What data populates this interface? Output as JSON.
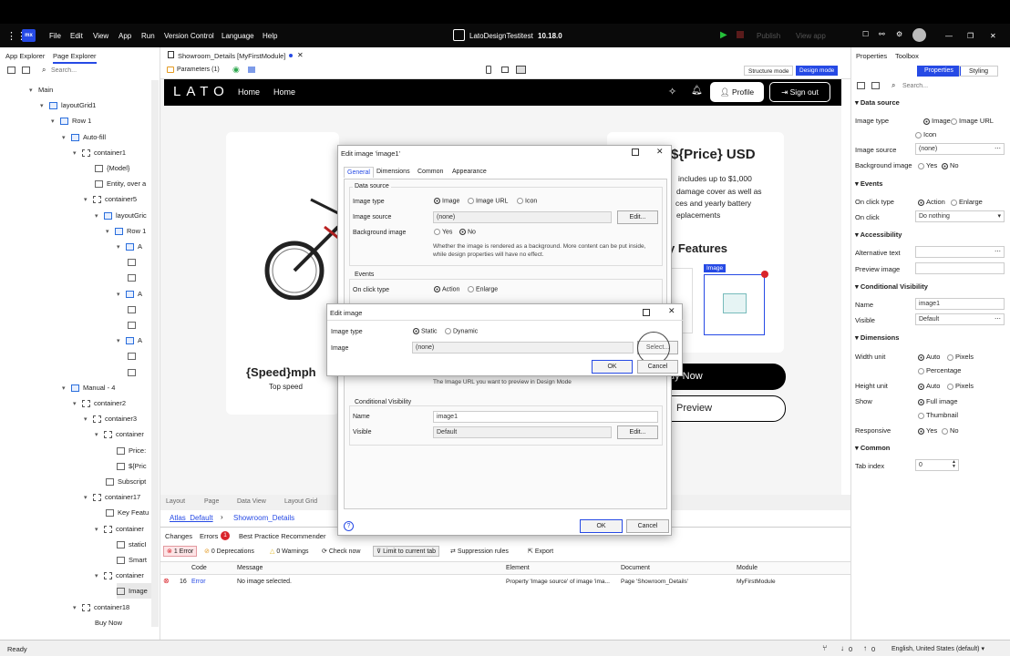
{
  "menubar": {
    "items": [
      "File",
      "Edit",
      "View",
      "App",
      "Run",
      "Version Control",
      "Language",
      "Help"
    ],
    "project_title": "LatoDesignTestitest",
    "version": "10.18.0",
    "publish_label": "Publish",
    "view_app_label": "View app"
  },
  "left_panel": {
    "tabs": [
      "App Explorer",
      "Page Explorer"
    ],
    "search_placeholder": "Search...",
    "tree": [
      {
        "label": "Main",
        "indent": 32,
        "chev": "▾",
        "icon": "none"
      },
      {
        "label": "layoutGrid1",
        "indent": 44,
        "chev": "▾",
        "icon": "grid"
      },
      {
        "label": "Row 1",
        "indent": 56,
        "chev": "▾",
        "icon": "row"
      },
      {
        "label": "Auto-fill",
        "indent": 68,
        "chev": "▾",
        "icon": "col"
      },
      {
        "label": "container1",
        "indent": 80,
        "chev": "▾",
        "icon": "dash"
      },
      {
        "label": "{Model}",
        "indent": 104,
        "chev": "",
        "icon": "text"
      },
      {
        "label": "Entity, over a",
        "indent": 104,
        "chev": "",
        "icon": "text"
      },
      {
        "label": "container5",
        "indent": 92,
        "chev": "▾",
        "icon": "dash"
      },
      {
        "label": "layoutGric",
        "indent": 104,
        "chev": "▾",
        "icon": "grid"
      },
      {
        "label": "Row 1",
        "indent": 116,
        "chev": "▾",
        "icon": "row"
      },
      {
        "label": "A",
        "indent": 128,
        "chev": "▾",
        "icon": "col"
      },
      {
        "label": "",
        "indent": 140,
        "chev": "",
        "icon": "text"
      },
      {
        "label": "",
        "indent": 140,
        "chev": "",
        "icon": "text"
      },
      {
        "label": "A",
        "indent": 128,
        "chev": "▾",
        "icon": "col"
      },
      {
        "label": "",
        "indent": 140,
        "chev": "",
        "icon": "text"
      },
      {
        "label": "",
        "indent": 140,
        "chev": "",
        "icon": "text"
      },
      {
        "label": "A",
        "indent": 128,
        "chev": "▾",
        "icon": "col"
      },
      {
        "label": "",
        "indent": 140,
        "chev": "",
        "icon": "text"
      },
      {
        "label": "",
        "indent": 140,
        "chev": "",
        "icon": "text"
      },
      {
        "label": "Manual - 4",
        "indent": 68,
        "chev": "▾",
        "icon": "col"
      },
      {
        "label": "container2",
        "indent": 80,
        "chev": "▾",
        "icon": "dash"
      },
      {
        "label": "container3",
        "indent": 92,
        "chev": "▾",
        "icon": "dash"
      },
      {
        "label": "container",
        "indent": 104,
        "chev": "▾",
        "icon": "dash"
      },
      {
        "label": "Price:",
        "indent": 128,
        "chev": "",
        "icon": "text"
      },
      {
        "label": "${Pric",
        "indent": 128,
        "chev": "",
        "icon": "text"
      },
      {
        "label": "Subscript",
        "indent": 116,
        "chev": "",
        "icon": "text"
      },
      {
        "label": "container17",
        "indent": 92,
        "chev": "▾",
        "icon": "dash"
      },
      {
        "label": "Key Featu",
        "indent": 116,
        "chev": "",
        "icon": "text"
      },
      {
        "label": "container",
        "indent": 104,
        "chev": "▾",
        "icon": "dash"
      },
      {
        "label": "staticI",
        "indent": 128,
        "chev": "",
        "icon": "text"
      },
      {
        "label": "Smart",
        "indent": 128,
        "chev": "",
        "icon": "text"
      },
      {
        "label": "container",
        "indent": 104,
        "chev": "▾",
        "icon": "dash"
      },
      {
        "label": "Image",
        "indent": 128,
        "chev": "",
        "icon": "img"
      },
      {
        "label": "container18",
        "indent": 80,
        "chev": "▾",
        "icon": "dash"
      },
      {
        "label": "Buy Now",
        "indent": 104,
        "chev": "",
        "icon": "none"
      }
    ]
  },
  "doc_tab": {
    "title": "Showroom_Details [MyFirstModule]",
    "parameters": "Parameters (1)",
    "structure_mode": "Structure mode",
    "design_mode": "Design mode"
  },
  "canvas": {
    "brand": "LATO",
    "nav": [
      "Home",
      "Home"
    ],
    "profile_label": "Profile",
    "signout_label": "Sign out",
    "price_heading": "${Price} USD",
    "description": [
      "includes up to $1,000",
      "damage cover as well as",
      "ces and yearly battery",
      "eplacements"
    ],
    "features_heading": "y Features",
    "image_badge": "Image",
    "speed_title": "{Speed}mph",
    "speed_sub": "Top speed",
    "buy_now": "uy Now",
    "preview": "Preview"
  },
  "bottom_tabs": [
    "Layout",
    "Page",
    "Data View",
    "Layout Grid"
  ],
  "breadcrumb": [
    "Atlas_Default",
    "Showroom_Details"
  ],
  "errors_panel": {
    "tabs": [
      "Changes",
      "Errors",
      "Best Practice Recommender"
    ],
    "errors_badge": "1",
    "toolbar": [
      "1 Error",
      "0 Deprecations",
      "0 Warnings",
      "Check now",
      "Limit to current tab",
      "Suppression rules",
      "Export"
    ],
    "columns": [
      "Code",
      "Message",
      "Element",
      "Document",
      "Module"
    ],
    "row": {
      "code": "16",
      "type": "Error",
      "message": "No image selected.",
      "element": "Property 'Image source' of image 'ima...",
      "document": "Page 'Showroom_Details'",
      "module": "MyFirstModule"
    }
  },
  "status_bar": {
    "left": "Ready",
    "count1": "0",
    "count2": "0",
    "locale": "English, United States (default)"
  },
  "right_panel": {
    "tabs": [
      "Properties",
      "Toolbox"
    ],
    "subtabs": [
      "Properties",
      "Styling"
    ],
    "search_placeholder": "Search...",
    "sections": {
      "data_source": "Data source",
      "events": "Events",
      "accessibility": "Accessibility",
      "conditional_visibility": "Conditional Visibility",
      "dimensions": "Dimensions",
      "common": "Common"
    },
    "image_type_label": "Image type",
    "image_type_options": [
      "Image",
      "Image URL",
      "Icon"
    ],
    "image_source_label": "Image source",
    "image_source_value": "(none)",
    "background_label": "Background image",
    "yes": "Yes",
    "no": "No",
    "on_click_type_label": "On click type",
    "action": "Action",
    "enlarge": "Enlarge",
    "on_click_label": "On click",
    "on_click_value": "Do nothing",
    "alt_text_label": "Alternative text",
    "preview_image_label": "Preview image",
    "name_label": "Name",
    "name_value": "image1",
    "visible_label": "Visible",
    "visible_value": "Default",
    "width_unit_label": "Width unit",
    "height_unit_label": "Height unit",
    "auto": "Auto",
    "pixels": "Pixels",
    "percentage": "Percentage",
    "show_label": "Show",
    "full_image": "Full image",
    "thumbnail": "Thumbnail",
    "responsive_label": "Responsive",
    "tab_index_label": "Tab index",
    "tab_index_value": "0"
  },
  "edit_image_dialog": {
    "title": "Edit image 'image1'",
    "tabs": [
      "General",
      "Dimensions",
      "Common",
      "Appearance"
    ],
    "data_source": "Data source",
    "image_type_label": "Image type",
    "image_type_options": [
      "Image",
      "Image URL",
      "Icon"
    ],
    "image_source_label": "Image source",
    "image_source_value": "(none)",
    "edit_label": "Edit...",
    "background_label": "Background image",
    "yes": "Yes",
    "no": "No",
    "bg_help": "Whether the image is rendered as a background. More content can be put inside, while design properties will have no effect.",
    "events": "Events",
    "on_click_type_label": "On click type",
    "action": "Action",
    "enlarge": "Enlarge",
    "preview_help": "The Image URL you want to preview in Design Mode",
    "cond_vis": "Conditional Visibility",
    "name_label": "Name",
    "name_value": "image1",
    "visible_label": "Visible",
    "visible_value": "Default",
    "ok": "OK",
    "cancel": "Cancel"
  },
  "edit_image_inner": {
    "title": "Edit image",
    "image_type_label": "Image type",
    "static": "Static",
    "dynamic": "Dynamic",
    "image_label": "Image",
    "image_value": "(none)",
    "select_label": "Select...",
    "ok": "OK",
    "cancel": "Cancel"
  }
}
